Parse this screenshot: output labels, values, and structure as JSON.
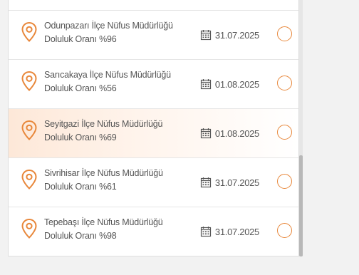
{
  "colors": {
    "accent": "#e8873a",
    "highlight": "#fde8d8",
    "text": "#555555"
  },
  "offices": [
    {
      "name": "Odunpazarı İlçe Nüfus Müdürlüğü",
      "occupancy": "Doluluk Oranı %96",
      "date": "31.07.2025",
      "selected": false,
      "highlighted": false
    },
    {
      "name": "Sarıcakaya İlçe Nüfus Müdürlüğü",
      "occupancy": "Doluluk Oranı %56",
      "date": "01.08.2025",
      "selected": false,
      "highlighted": false
    },
    {
      "name": "Seyitgazi İlçe Nüfus Müdürlüğü",
      "occupancy": "Doluluk Oranı %69",
      "date": "01.08.2025",
      "selected": false,
      "highlighted": true
    },
    {
      "name": "Sivrihisar İlçe Nüfus Müdürlüğü",
      "occupancy": "Doluluk Oranı %61",
      "date": "31.07.2025",
      "selected": false,
      "highlighted": false
    },
    {
      "name": "Tepebaşı İlçe Nüfus Müdürlüğü",
      "occupancy": "Doluluk Oranı %98",
      "date": "31.07.2025",
      "selected": false,
      "highlighted": false
    }
  ],
  "icons": {
    "location": "map-pin-icon",
    "date": "calendar-icon"
  }
}
